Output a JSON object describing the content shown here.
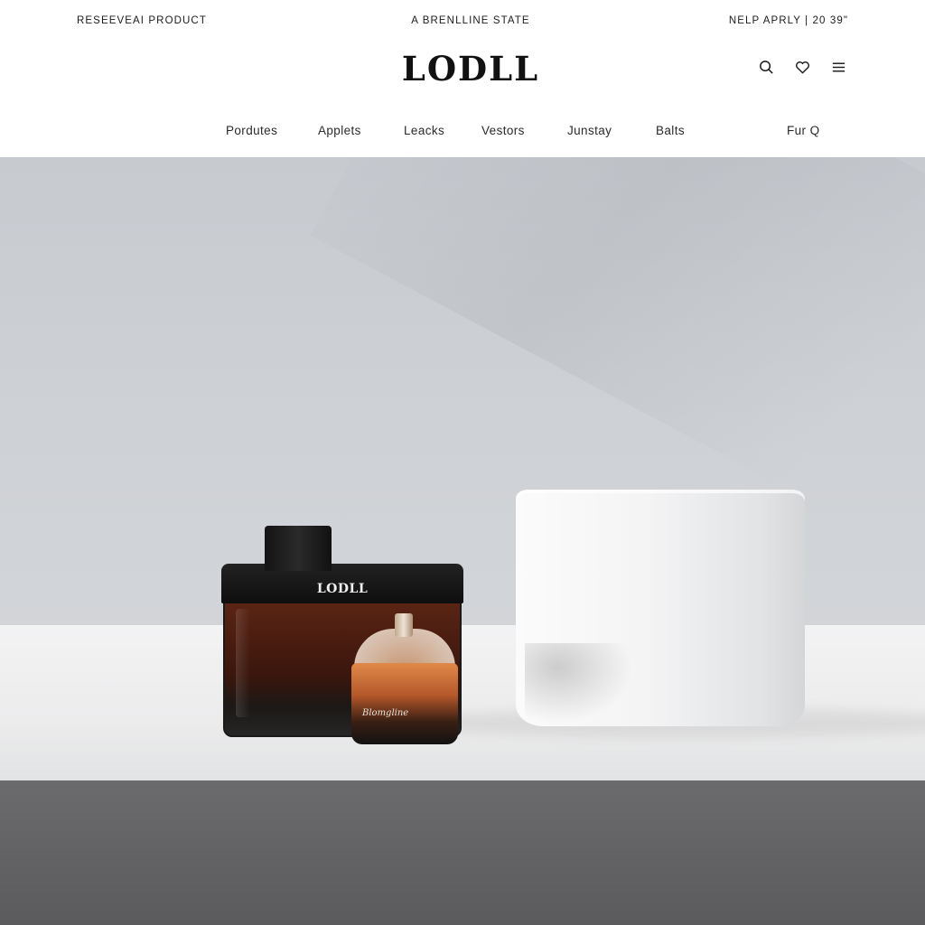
{
  "top_bar": {
    "left_text": "RESEEVEAI PRODUCT",
    "center_text": "A BRENLLINE STATE",
    "right_text": "NELP APRLY | 20 39\""
  },
  "brand": {
    "logo": "LODLL"
  },
  "header_icons": [
    {
      "name": "search-icon"
    },
    {
      "name": "heart-icon"
    },
    {
      "name": "menu-icon"
    }
  ],
  "nav": {
    "items": [
      "Pordutes",
      "Applets",
      "Leacks",
      "Vestors",
      "Junstay",
      "Balts"
    ],
    "right_item": "Fur Q"
  },
  "hero": {
    "box_label": "LODLL",
    "bottle_label": "Blomgline"
  },
  "colors": {
    "header_bg": "#ffffff",
    "hero_wall": "#cfd2d6",
    "shelf": "#ececed",
    "amber": "#b4572a"
  }
}
